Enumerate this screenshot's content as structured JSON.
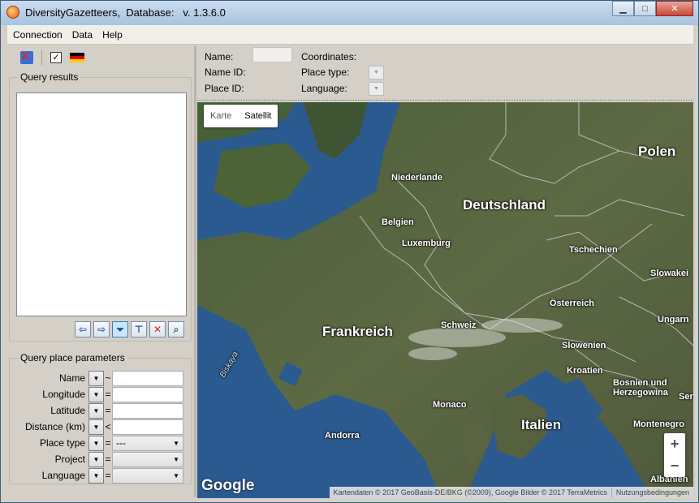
{
  "window": {
    "title": "DiversityGazetteers,  Database:   v. 1.3.6.0",
    "minimize_icon": "minimize-icon",
    "maximize_icon": "maximize-icon",
    "close_icon": "close-icon"
  },
  "menu": {
    "items": [
      "Connection",
      "Data",
      "Help"
    ]
  },
  "left_toolbar": {
    "icons": [
      "database-disconnected-icon",
      "checkbox-icon",
      "german-flag-icon"
    ]
  },
  "query_results": {
    "legend": "Query results",
    "buttons": [
      "arrow-left-icon",
      "arrow-right-icon",
      "filter-icon",
      "filter-add-icon",
      "filter-remove-icon",
      "map-search-icon"
    ]
  },
  "query_params": {
    "legend": "Query place parameters",
    "rows": [
      {
        "label": "Name",
        "op": "~",
        "kind": "input",
        "value": ""
      },
      {
        "label": "Longitude",
        "op": "=",
        "kind": "input",
        "value": ""
      },
      {
        "label": "Latitude",
        "op": "=",
        "kind": "input",
        "value": ""
      },
      {
        "label": "Distance (km)",
        "op": "<",
        "kind": "input",
        "value": ""
      },
      {
        "label": "Place type",
        "op": "=",
        "kind": "select",
        "value": "---"
      },
      {
        "label": "Project",
        "op": "=",
        "kind": "select",
        "value": ""
      },
      {
        "label": "Language",
        "op": "=",
        "kind": "select",
        "value": ""
      }
    ]
  },
  "info": {
    "name_label": "Name:",
    "name_id_label": "Name ID:",
    "place_id_label": "Place ID:",
    "coordinates_label": "Coordinates:",
    "place_type_label": "Place type:",
    "language_label": "Language:"
  },
  "map": {
    "type_buttons": {
      "map": "Karte",
      "satellite": "Satellit"
    },
    "labels": {
      "niederlande": "Niederlande",
      "belgien": "Belgien",
      "luxemburg": "Luxemburg",
      "deutschland": "Deutschland",
      "polen": "Polen",
      "tschechien": "Tschechien",
      "slowakei": "Slowakei",
      "oesterreich": "Österreich",
      "ungarn": "Ungarn",
      "frankreich": "Frankreich",
      "schweiz": "Schweiz",
      "slowenien": "Slowenien",
      "kroatien": "Kroatien",
      "bosnien": "Bosnien und Herzegowina",
      "serbien": "Ser",
      "monaco": "Monaco",
      "italien": "Italien",
      "andorra": "Andorra",
      "montenegro": "Montenegro",
      "albanien": "Albanien",
      "biskaya": "Biskaya"
    },
    "google": "Google",
    "attribution": "Kartendaten © 2017 GeoBasis-DE/BKG (©2009), Google Bilder © 2017 TerraMetrics",
    "terms": "Nutzungsbedingungen",
    "zoom_in": "+",
    "zoom_out": "−"
  }
}
